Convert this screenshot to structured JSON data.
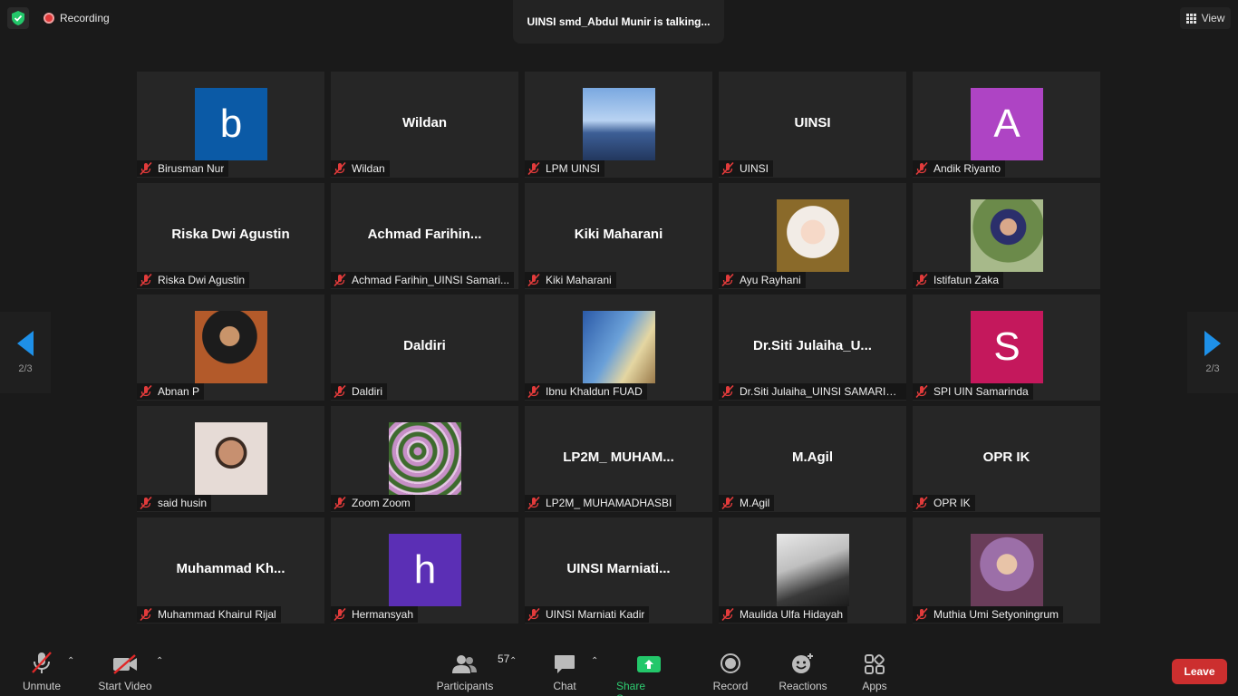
{
  "top": {
    "recording_label": "Recording",
    "talking_label": "UINSI smd_Abdul Munir is talking...",
    "view_label": "View"
  },
  "paging": {
    "left_label": "2/3",
    "right_label": "2/3"
  },
  "tiles": [
    {
      "name": "Birusman Nur",
      "center": "",
      "avatar_letter": "b",
      "avatar_color": "#0b5aa6",
      "photo": ""
    },
    {
      "name": "Wildan",
      "center": "Wildan",
      "avatar_letter": "",
      "avatar_color": "",
      "photo": ""
    },
    {
      "name": "LPM UINSI",
      "center": "",
      "avatar_letter": "",
      "avatar_color": "",
      "photo": "mosque"
    },
    {
      "name": "UINSI",
      "center": "UINSI",
      "avatar_letter": "",
      "avatar_color": "",
      "photo": ""
    },
    {
      "name": "Andik Riyanto",
      "center": "",
      "avatar_letter": "A",
      "avatar_color": "#ae44c4",
      "photo": ""
    },
    {
      "name": "Riska Dwi Agustin",
      "center": "Riska Dwi Agustin",
      "avatar_letter": "",
      "avatar_color": "",
      "photo": ""
    },
    {
      "name": "Achmad Farihin_UINSI Samari...",
      "center": "Achmad  Farihin...",
      "avatar_letter": "",
      "avatar_color": "",
      "photo": ""
    },
    {
      "name": "Kiki Maharani",
      "center": "Kiki Maharani",
      "avatar_letter": "",
      "avatar_color": "",
      "photo": ""
    },
    {
      "name": "Ayu Rayhani",
      "center": "",
      "avatar_letter": "",
      "avatar_color": "",
      "photo": "portrait-hijab-white"
    },
    {
      "name": "Istifatun Zaka",
      "center": "",
      "avatar_letter": "",
      "avatar_color": "",
      "photo": "portrait-outdoor"
    },
    {
      "name": "Abnan P",
      "center": "",
      "avatar_letter": "",
      "avatar_color": "",
      "photo": "graduation"
    },
    {
      "name": "Daldiri",
      "center": "Daldiri",
      "avatar_letter": "",
      "avatar_color": "",
      "photo": ""
    },
    {
      "name": "Ibnu Khaldun FUAD",
      "center": "",
      "avatar_letter": "",
      "avatar_color": "",
      "photo": "couple"
    },
    {
      "name": "Dr.Siti Julaiha_UINSI SAMARIN...",
      "center": "Dr.Siti  Julaiha_U...",
      "avatar_letter": "",
      "avatar_color": "",
      "photo": ""
    },
    {
      "name": "SPI UIN Samarinda",
      "center": "",
      "avatar_letter": "S",
      "avatar_color": "#c4185c",
      "photo": ""
    },
    {
      "name": "said husin",
      "center": "",
      "avatar_letter": "",
      "avatar_color": "",
      "photo": "man-glasses"
    },
    {
      "name": "Zoom Zoom",
      "center": "",
      "avatar_letter": "",
      "avatar_color": "",
      "photo": "flowers"
    },
    {
      "name": "LP2M_ MUHAMADHASBI",
      "center": "LP2M_  MUHAM...",
      "avatar_letter": "",
      "avatar_color": "",
      "photo": ""
    },
    {
      "name": "M.Agil",
      "center": "M.Agil",
      "avatar_letter": "",
      "avatar_color": "",
      "photo": ""
    },
    {
      "name": "OPR IK",
      "center": "OPR IK",
      "avatar_letter": "",
      "avatar_color": "",
      "photo": ""
    },
    {
      "name": "Muhammad Khairul Rijal",
      "center": "Muhammad  Kh...",
      "avatar_letter": "",
      "avatar_color": "",
      "photo": ""
    },
    {
      "name": "Hermansyah",
      "center": "",
      "avatar_letter": "h",
      "avatar_color": "#5b2fb5",
      "photo": ""
    },
    {
      "name": "UINSI Marniati Kadir",
      "center": "UINSI  Marniati...",
      "avatar_letter": "",
      "avatar_color": "",
      "photo": ""
    },
    {
      "name": "Maulida Ulfa Hidayah",
      "center": "",
      "avatar_letter": "",
      "avatar_color": "",
      "photo": "classroom"
    },
    {
      "name": "Muthia Umi Setyoningrum",
      "center": "",
      "avatar_letter": "",
      "avatar_color": "",
      "photo": "portrait-hijab-purple"
    }
  ],
  "toolbar": {
    "unmute_label": "Unmute",
    "start_video_label": "Start Video",
    "participants_label": "Participants",
    "participants_count": "57",
    "chat_label": "Chat",
    "share_label": "Share Screen",
    "record_label": "Record",
    "reactions_label": "Reactions",
    "apps_label": "Apps",
    "leave_label": "Leave"
  }
}
